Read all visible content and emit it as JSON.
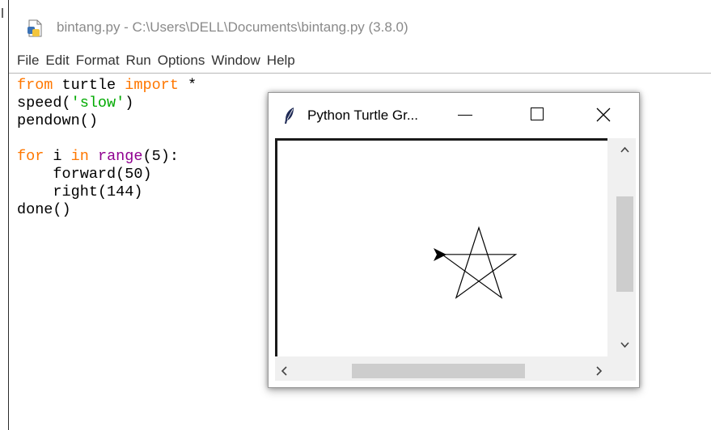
{
  "idle": {
    "title": "bintang.py - C:\\Users\\DELL\\Documents\\bintang.py (3.8.0)",
    "title_icon": "python-file-icon",
    "menu": [
      "File",
      "Edit",
      "Format",
      "Run",
      "Options",
      "Window",
      "Help"
    ],
    "code_lines": [
      "from turtle import *",
      "speed('slow')",
      "pendown()",
      "",
      "for i in range(5):",
      "    forward(50)",
      "    right(144)",
      "done()"
    ],
    "syntax_colors": {
      "keyword": "#ff7700",
      "string": "#00aa00",
      "builtin": "#900090",
      "default": "#000000"
    }
  },
  "turtle_window": {
    "title": "Python Turtle Gr...",
    "title_icon": "feather-icon",
    "controls": [
      "minimize-icon",
      "maximize-icon",
      "close-icon"
    ],
    "drawing": "five-pointed-star",
    "pen_color": "#000000"
  }
}
